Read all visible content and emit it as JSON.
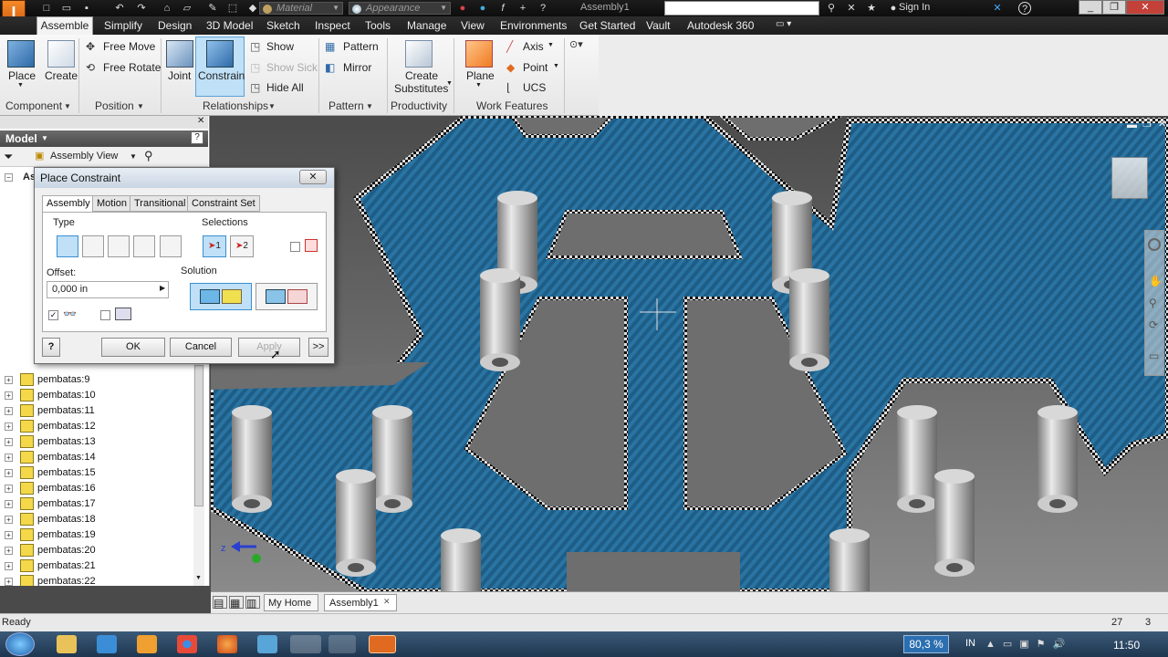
{
  "titlebar": {
    "material_placeholder": "Material",
    "appearance_placeholder": "Appearance",
    "doc_title": "Assembly1",
    "sign_in": "Sign In"
  },
  "menu": {
    "active": "Assemble",
    "items": [
      "Simplify",
      "Design",
      "3D Model",
      "Sketch",
      "Inspect",
      "Tools",
      "Manage",
      "View",
      "Environments",
      "Get Started",
      "Vault",
      "Autodesk 360"
    ]
  },
  "ribbon": {
    "component": {
      "place": "Place",
      "create": "Create",
      "label": "Component"
    },
    "position": {
      "free_move": "Free Move",
      "free_rotate": "Free Rotate",
      "label": "Position"
    },
    "relationships": {
      "joint": "Joint",
      "constrain": "Constrain",
      "show": "Show",
      "show_sick": "Show Sick",
      "hide_all": "Hide All",
      "label": "Relationships"
    },
    "pattern": {
      "pattern": "Pattern",
      "mirror": "Mirror",
      "label": "Pattern"
    },
    "productivity": {
      "create_substitutes_1": "Create",
      "create_substitutes_2": "Substitutes",
      "label": "Productivity"
    },
    "work_features": {
      "plane": "Plane",
      "axis": "Axis",
      "point": "Point",
      "ucs": "UCS",
      "label": "Work Features"
    }
  },
  "model_panel": {
    "title": "Model",
    "view": "Assembly View",
    "root_partial": "As",
    "items": [
      "pembatas:9",
      "pembatas:10",
      "pembatas:11",
      "pembatas:12",
      "pembatas:13",
      "pembatas:14",
      "pembatas:15",
      "pembatas:16",
      "pembatas:17",
      "pembatas:18",
      "pembatas:19",
      "pembatas:20",
      "pembatas:21",
      "pembatas:22"
    ]
  },
  "dialog": {
    "title": "Place Constraint",
    "tabs": [
      "Assembly",
      "Motion",
      "Transitional",
      "Constraint Set"
    ],
    "type_label": "Type",
    "selections_label": "Selections",
    "sel1": "1",
    "sel2": "2",
    "offset_label": "Offset:",
    "offset_value": "0,000 in",
    "solution_label": "Solution",
    "ok": "OK",
    "cancel": "Cancel",
    "apply": "Apply",
    "more": ">>",
    "help": "?"
  },
  "doc_tabs": {
    "home": "My Home",
    "doc": "Assembly1"
  },
  "status": {
    "text": "Ready",
    "count1": "27",
    "count2": "3"
  },
  "taskbar": {
    "zoom": "80,3 %",
    "lang": "IN",
    "time": "11:50"
  },
  "colors": {
    "accent": "#3a8fd0",
    "plate": "#1f5f86",
    "ribbon_active": "#bfe0f7"
  }
}
